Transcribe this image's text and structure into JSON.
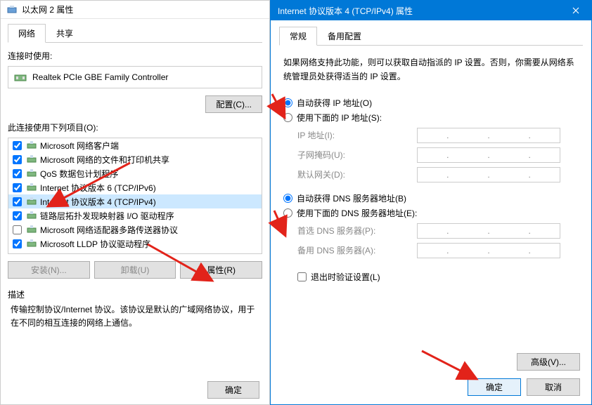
{
  "left": {
    "title": "以太网 2 属性",
    "tabs": {
      "network": "网络",
      "sharing": "共享"
    },
    "connect_using": "连接时使用:",
    "adapter_name": "Realtek PCIe GBE Family Controller",
    "configure_btn": "配置(C)...",
    "items_label": "此连接使用下列项目(O):",
    "items": [
      {
        "label": "Microsoft 网络客户端",
        "checked": true
      },
      {
        "label": "Microsoft 网络的文件和打印机共享",
        "checked": true
      },
      {
        "label": "QoS 数据包计划程序",
        "checked": true
      },
      {
        "label": "Internet 协议版本 6 (TCP/IPv6)",
        "checked": true
      },
      {
        "label": "Internet 协议版本 4 (TCP/IPv4)",
        "checked": true,
        "selected": true
      },
      {
        "label": "链路层拓扑发现映射器 I/O 驱动程序",
        "checked": true
      },
      {
        "label": "Microsoft 网络适配器多路传送器协议",
        "checked": false
      },
      {
        "label": "Microsoft LLDP 协议驱动程序",
        "checked": true
      }
    ],
    "install_btn": "安装(N)...",
    "uninstall_btn": "卸载(U)",
    "properties_btn": "属性(R)",
    "desc_label": "描述",
    "desc_text": "传输控制协议/Internet 协议。该协议是默认的广域网络协议，用于在不同的相互连接的网络上通信。",
    "ok_btn": "确定"
  },
  "right": {
    "title": "Internet 协议版本 4 (TCP/IPv4) 属性",
    "tabs": {
      "general": "常规",
      "alternate": "备用配置"
    },
    "help_text": "如果网络支持此功能，则可以获取自动指派的 IP 设置。否则，你需要从网络系统管理员处获得适当的 IP 设置。",
    "ip_auto": "自动获得 IP 地址(O)",
    "ip_manual": "使用下面的 IP 地址(S):",
    "ip_address_label": "IP 地址(I):",
    "subnet_label": "子网掩码(U):",
    "gateway_label": "默认网关(D):",
    "dns_auto": "自动获得 DNS 服务器地址(B)",
    "dns_manual": "使用下面的 DNS 服务器地址(E):",
    "dns_pref_label": "首选 DNS 服务器(P):",
    "dns_alt_label": "备用 DNS 服务器(A):",
    "validate_label": "退出时验证设置(L)",
    "advanced_btn": "高级(V)...",
    "ok_btn": "确定",
    "cancel_btn": "取消"
  }
}
